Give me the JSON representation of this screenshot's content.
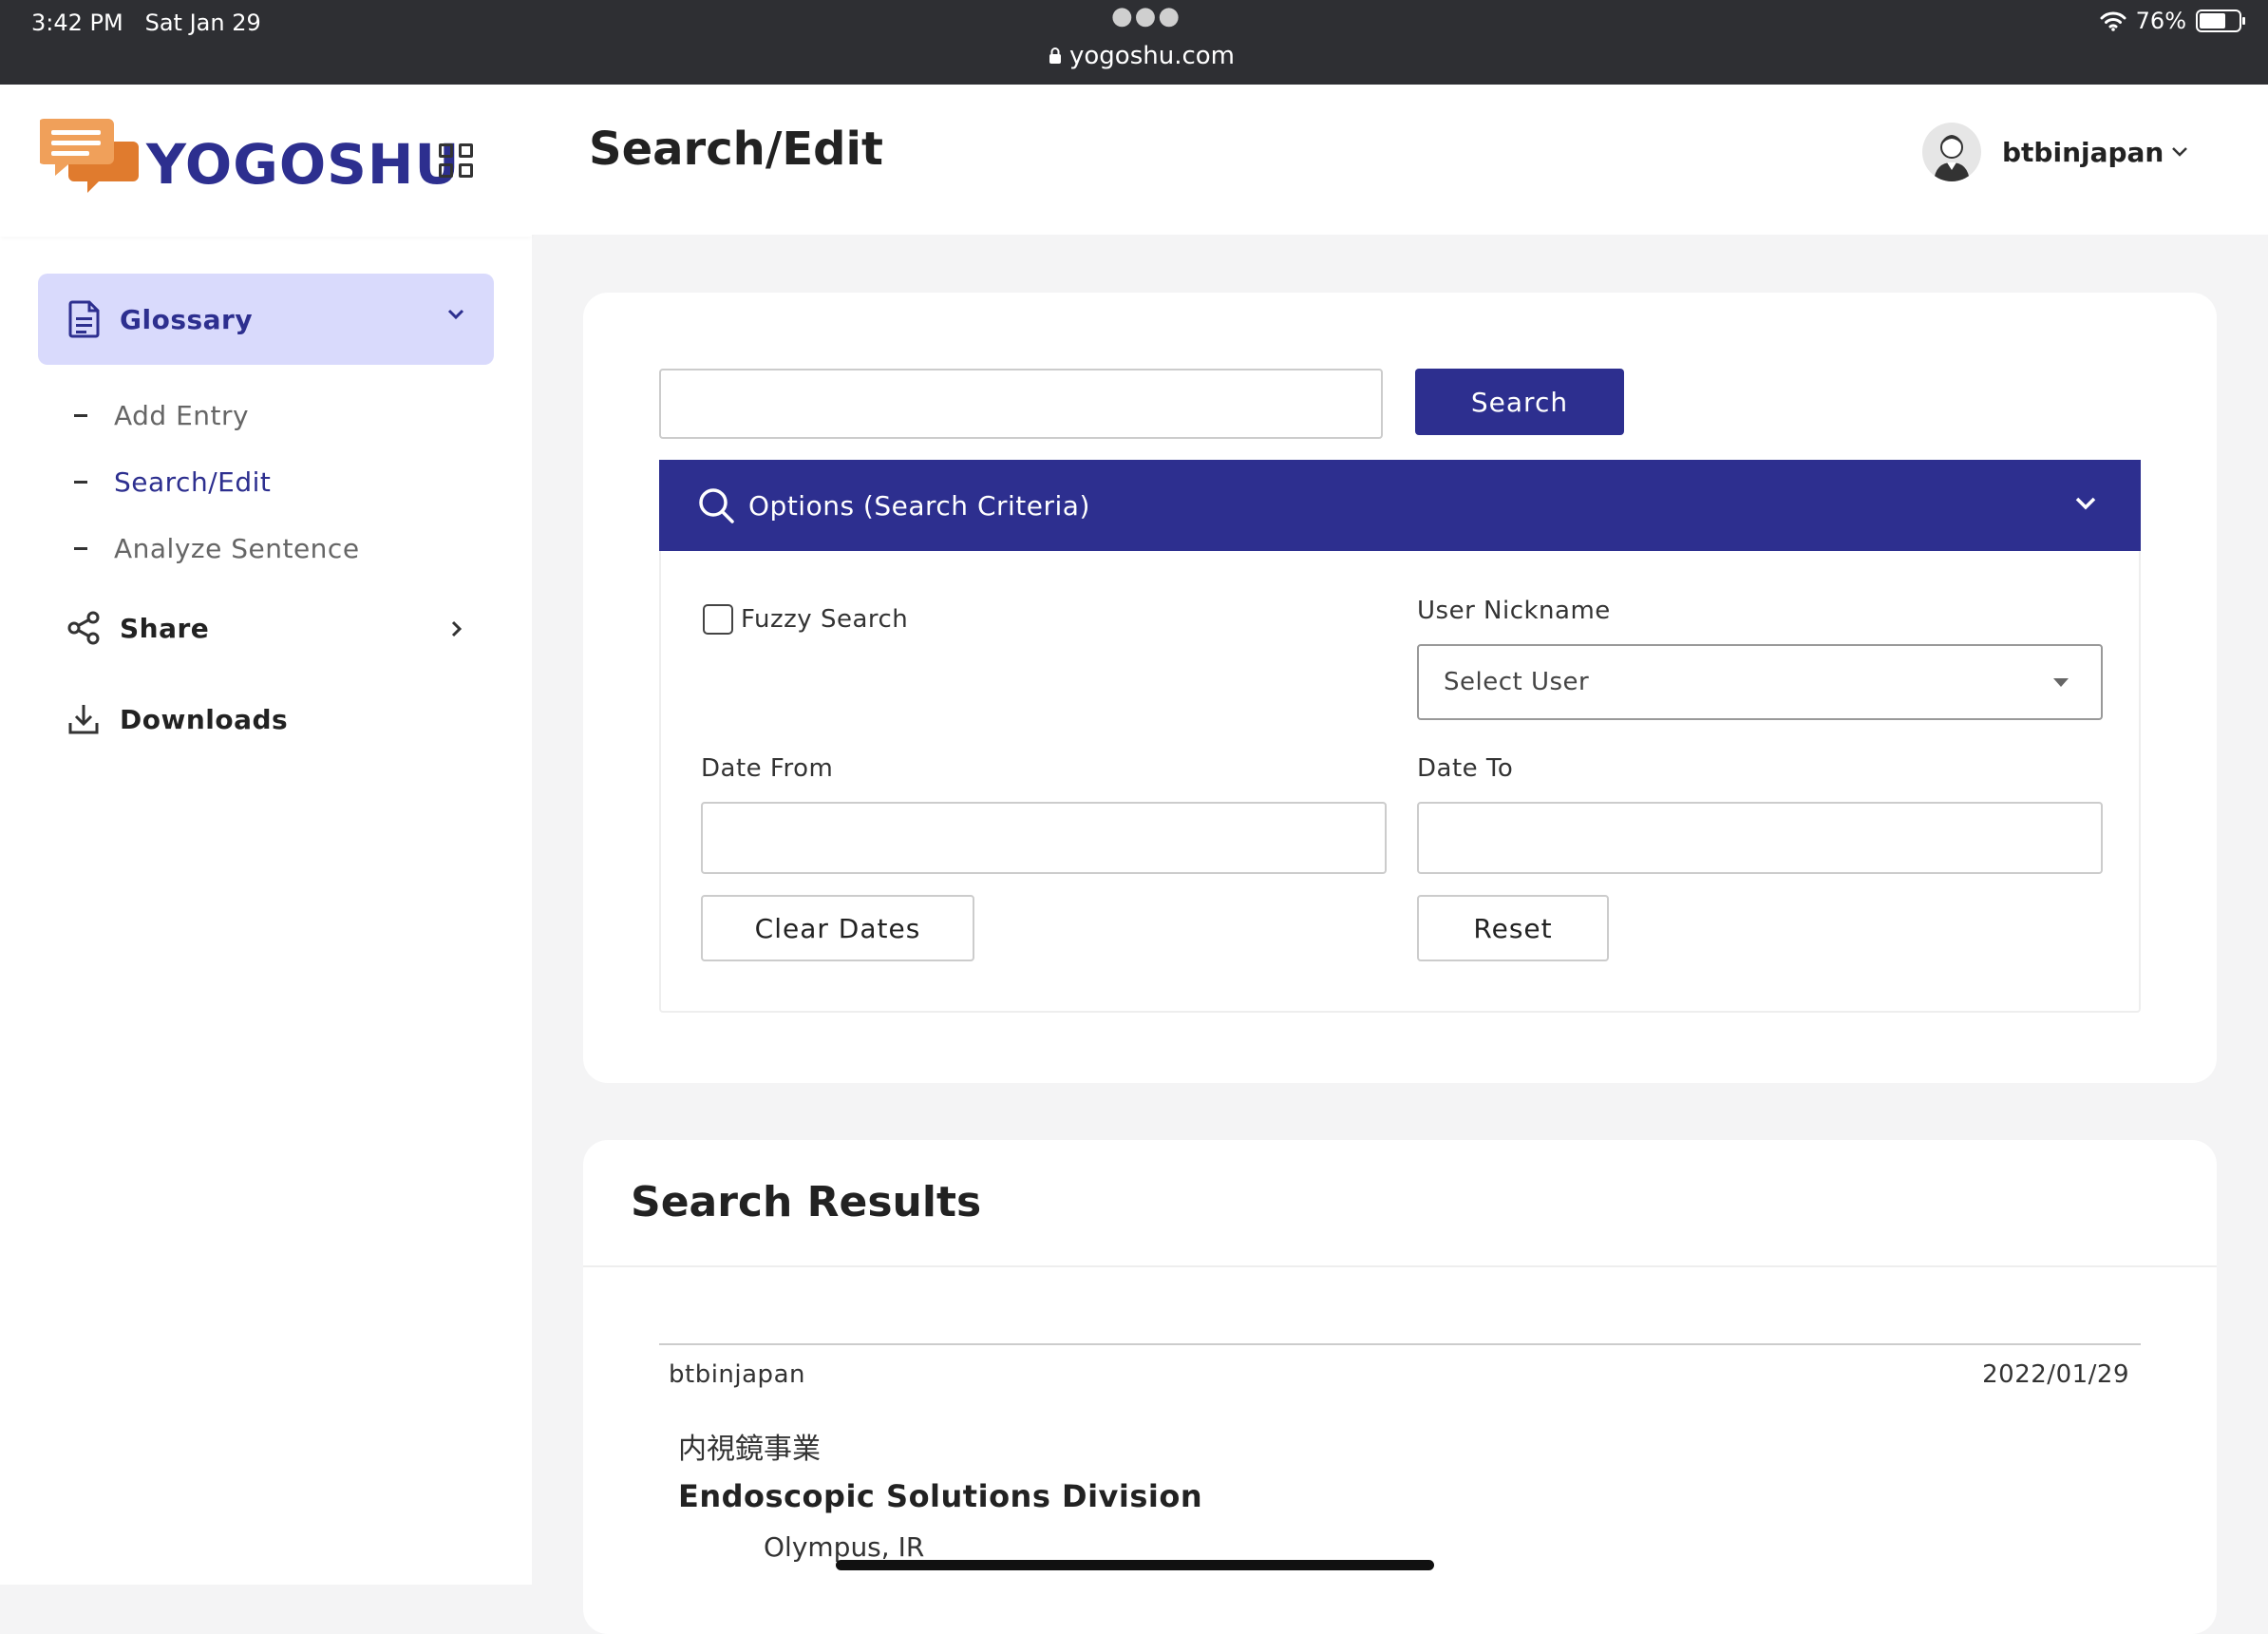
{
  "status_bar": {
    "time": "3:42 PM",
    "date": "Sat Jan 29",
    "url": "yogoshu.com",
    "battery": "76%",
    "battery_level": 0.76
  },
  "brand": {
    "name": "YOGOSHU",
    "accent": "#2d2f8f",
    "logo_color": "#e8873a"
  },
  "sidebar": {
    "glossary_label": "Glossary",
    "sub_items": [
      {
        "label": "Add Entry"
      },
      {
        "label": "Search/Edit"
      },
      {
        "label": "Analyze Sentence"
      }
    ],
    "share_label": "Share",
    "downloads_label": "Downloads"
  },
  "header": {
    "title": "Search/Edit",
    "username": "btbinjapan"
  },
  "search": {
    "input_value": "",
    "button_label": "Search",
    "options_title": "Options (Search Criteria)",
    "fuzzy_label": "Fuzzy Search",
    "fuzzy_checked": false,
    "user_nickname_label": "User Nickname",
    "select_user_value": "Select User",
    "date_from_label": "Date From",
    "date_to_label": "Date To",
    "clear_dates_label": "Clear Dates",
    "reset_label": "Reset"
  },
  "results": {
    "title": "Search Results",
    "items": [
      {
        "user": "btbinjapan",
        "date": "2022/01/29",
        "term_ja": "内視鏡事業",
        "term_en": "Endoscopic Solutions Division",
        "source": "Olympus, IR"
      }
    ]
  }
}
